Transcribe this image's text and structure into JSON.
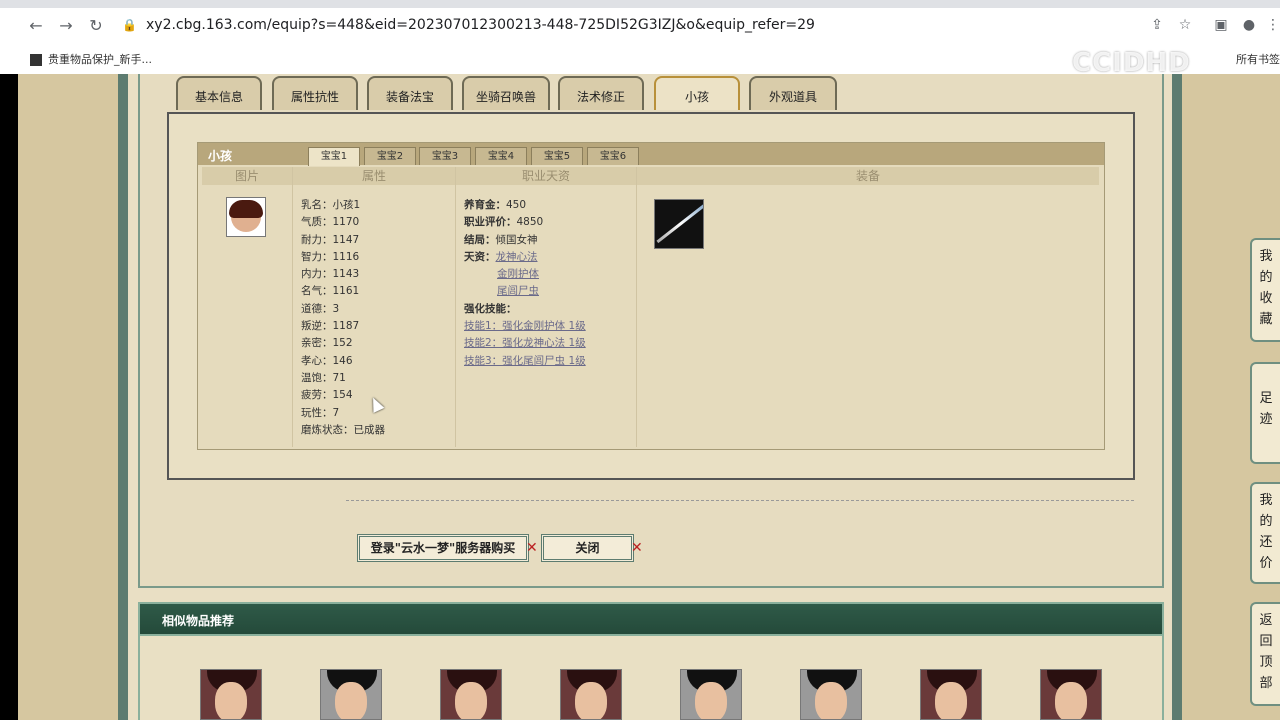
{
  "browser": {
    "url": "xy2.cbg.163.com/equip?s=448&eid=202307012300213-448-725DI52G3IZJ&o&equip_refer=29",
    "bookmark": "贵重物品保护_新手...",
    "bookmark_right": "所有书签"
  },
  "watermark": "CCIDHD",
  "tabs": [
    "基本信息",
    "属性抗性",
    "装备法宝",
    "坐骑召唤兽",
    "法术修正",
    "小孩",
    "外观道具"
  ],
  "active_tab": "小孩",
  "child_panel": {
    "label": "小孩",
    "subtabs": [
      "宝宝1",
      "宝宝2",
      "宝宝3",
      "宝宝4",
      "宝宝5",
      "宝宝6"
    ],
    "columns": [
      "图片",
      "属性",
      "职业天资",
      "装备"
    ],
    "attributes": [
      {
        "k": "乳名：",
        "v": "小孩1"
      },
      {
        "k": "气质：",
        "v": "1170"
      },
      {
        "k": "耐力：",
        "v": "1147"
      },
      {
        "k": "智力：",
        "v": "1116"
      },
      {
        "k": "内力：",
        "v": "1143"
      },
      {
        "k": "名气：",
        "v": "1161"
      },
      {
        "k": "道德：",
        "v": "3"
      },
      {
        "k": "叛逆：",
        "v": "1187"
      },
      {
        "k": "亲密：",
        "v": "152"
      },
      {
        "k": "孝心：",
        "v": "146"
      },
      {
        "k": "温饱：",
        "v": "71"
      },
      {
        "k": "疲劳：",
        "v": "154"
      },
      {
        "k": "玩性：",
        "v": "7"
      },
      {
        "k": "磨炼状态：",
        "v": "已成器"
      }
    ],
    "career": {
      "yangyu_label": "养育金：",
      "yangyu": "450",
      "score_label": "职业评价：",
      "score": "4850",
      "ending_label": "结局：",
      "ending": "倾国女神",
      "talent_label": "天资：",
      "talents": [
        "龙神心法",
        "金刚护体",
        "尾闾尸虫"
      ],
      "skills_label": "强化技能：",
      "skills": [
        "技能1：强化金刚护体 1级",
        "技能2：强化龙神心法 1级",
        "技能3：强化尾闾尸虫 1级"
      ]
    }
  },
  "buttons": {
    "buy": "登录\"云水一梦\"服务器购买",
    "close": "关闭"
  },
  "similar": {
    "title": "相似物品推荐"
  },
  "side": {
    "fav": "我的收藏",
    "trail": "足迹",
    "bargain": "我的还价",
    "top": "返回顶部"
  }
}
